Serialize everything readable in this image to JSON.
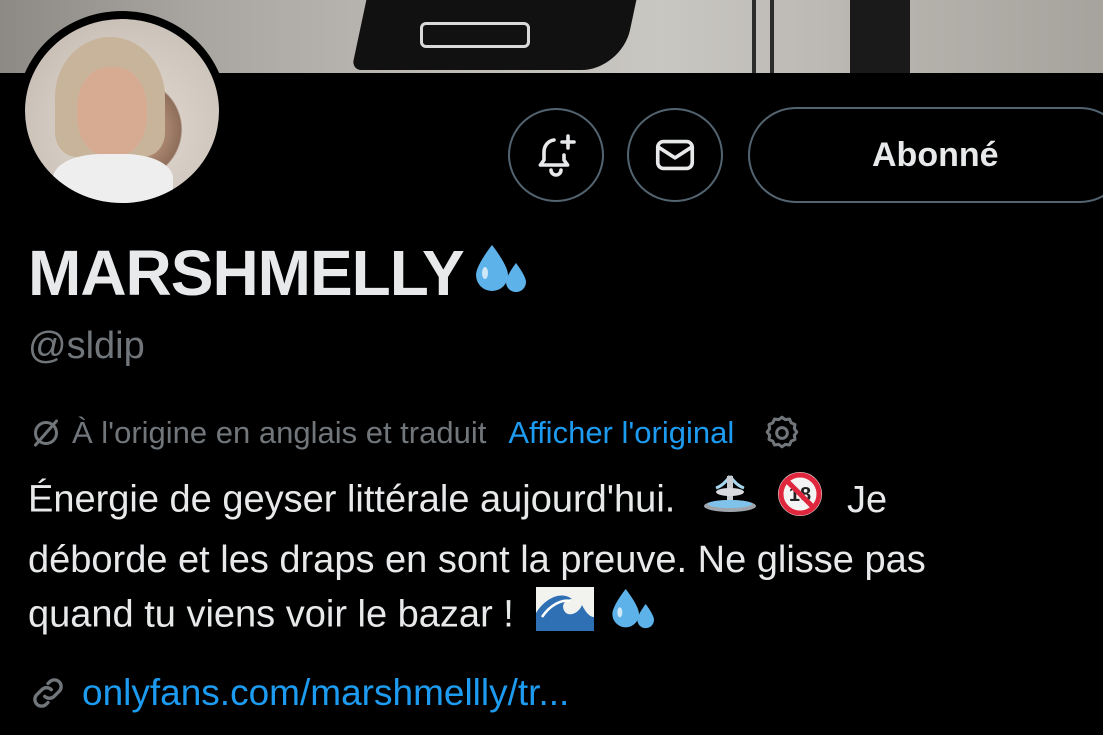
{
  "profile": {
    "display_name": "MARSHMELLY",
    "handle": "@sldip",
    "follow_label": "Abonné"
  },
  "translation": {
    "notice": "À l'origine en anglais et traduit",
    "show_original": "Afficher l'original"
  },
  "bio": {
    "line1": "Énergie de geyser littérale aujourd'hui.",
    "line1_end": "Je",
    "line2": "déborde et les draps en sont la preuve. Ne glisse pas",
    "line3": "quand tu viens voir le bazar !"
  },
  "link": {
    "url": "onlyfans.com/marshmellly/tr..."
  },
  "icons": {
    "notify": "bell-plus-icon",
    "message": "envelope-icon",
    "translate": "slashed-circle-icon",
    "settings": "gear-icon",
    "link": "link-icon",
    "droplets": "sweat-droplets-emoji",
    "fountain": "fountain-emoji",
    "no_under_18": "no-one-under-eighteen-emoji",
    "wave": "water-wave-emoji"
  },
  "colors": {
    "background": "#000000",
    "text": "#e7e9ea",
    "muted": "#71767b",
    "accent": "#1d9bf0",
    "border": "#536471"
  }
}
